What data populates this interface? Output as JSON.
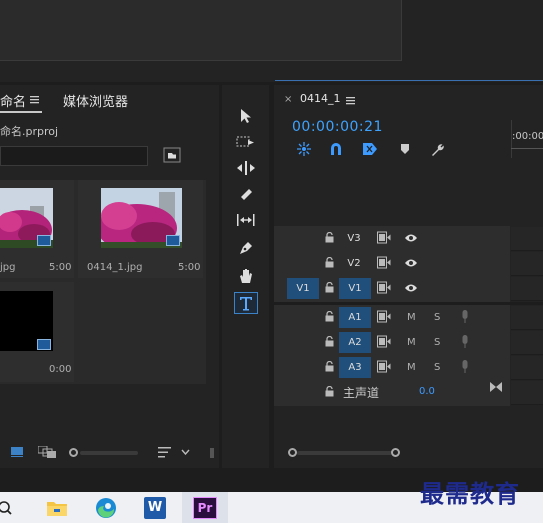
{
  "project_panel": {
    "tab_project": "命名",
    "tab_menu_icon": "hamburger-icon",
    "tab_media_browser": "媒体浏览器",
    "project_file": "命名.prproj",
    "clips": [
      {
        "name": "jpg",
        "duration": "5:00"
      },
      {
        "name": "0414_1.jpg",
        "duration": "5:00"
      },
      {
        "name": "",
        "duration": "0:00"
      }
    ]
  },
  "tools": [
    "selection-tool",
    "track-select-tool",
    "ripple-edit-tool",
    "razor-tool",
    "slip-tool",
    "pen-tool",
    "hand-tool",
    "type-tool"
  ],
  "timeline": {
    "sequence_name": "0414_1",
    "timecode": "00:00:00:21",
    "ruler_label": ":00:00",
    "video_tracks": [
      {
        "target": "",
        "label": "V3"
      },
      {
        "target": "",
        "label": "V2"
      },
      {
        "target": "V1",
        "label": "V1"
      }
    ],
    "audio_tracks": [
      {
        "label": "A1",
        "m": "M",
        "s": "S"
      },
      {
        "label": "A2",
        "m": "M",
        "s": "S"
      },
      {
        "label": "A3",
        "m": "M",
        "s": "S"
      }
    ],
    "master_label": "主声道",
    "master_value": "0.0"
  },
  "watermark": "最需教育",
  "taskbar": {
    "word_label": "W",
    "premiere_label": "Pr"
  }
}
